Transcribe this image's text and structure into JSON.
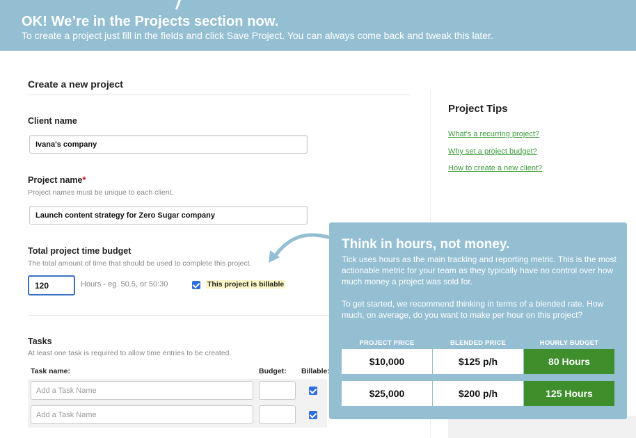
{
  "banner": {
    "title": "OK! We’re in the Projects section now.",
    "subtitle": "To create a project just fill in the fields and click Save Project. You can always come back and tweak this later."
  },
  "form": {
    "section_title": "Create a new project",
    "client": {
      "label": "Client name",
      "value": "Ivana's company"
    },
    "project": {
      "label": "Project name",
      "required_mark": "*",
      "hint": "Project names must be unique to each client.",
      "value": "Launch content strategy for Zero Sugar company"
    },
    "budget": {
      "label": "Total project time budget",
      "hint": "The total amount of time that should be used to complete this project.",
      "value": "120",
      "hours_hint": "Hours - eg. 50.5, or 50:30",
      "billable_label": "This project is billable",
      "billable_checked": true
    },
    "tasks": {
      "label": "Tasks",
      "hint": "At least one task is required to allow time entries to be created.",
      "col_task": "Task name:",
      "col_budget": "Budget:",
      "col_billable": "Billable:",
      "placeholder": "Add a Task Name",
      "rows": [
        {
          "name": "",
          "budget": "",
          "billable": true
        },
        {
          "name": "",
          "budget": "",
          "billable": true
        }
      ]
    }
  },
  "tips": {
    "title": "Project Tips",
    "links": [
      "What's a recurring project?",
      "Why set a project budget?",
      "How to create a new client?"
    ]
  },
  "popover": {
    "title": "Think in hours, not money.",
    "para1": "Tick uses hours as the main tracking and reporting metric. This is the most actionable metric for your team as they typically have no control over how much money a project was sold for.",
    "para2": "To get started, we recommend thinking in terms of a blended rate. How much, on average, do you want to make per hour on this project?",
    "table": {
      "headers": [
        "PROJECT PRICE",
        "BLENDED PRICE",
        "HOURLY BUDGET"
      ],
      "rows": [
        [
          "$10,000",
          "$125 p/h",
          "80 Hours"
        ],
        [
          "$25,000",
          "$200 p/h",
          "125 Hours"
        ]
      ]
    }
  },
  "colors": {
    "banner": "#94bfd3",
    "accent_green": "#3e8e2b",
    "link_green": "#3a9b3a",
    "focus_blue": "#3a6fc4"
  }
}
